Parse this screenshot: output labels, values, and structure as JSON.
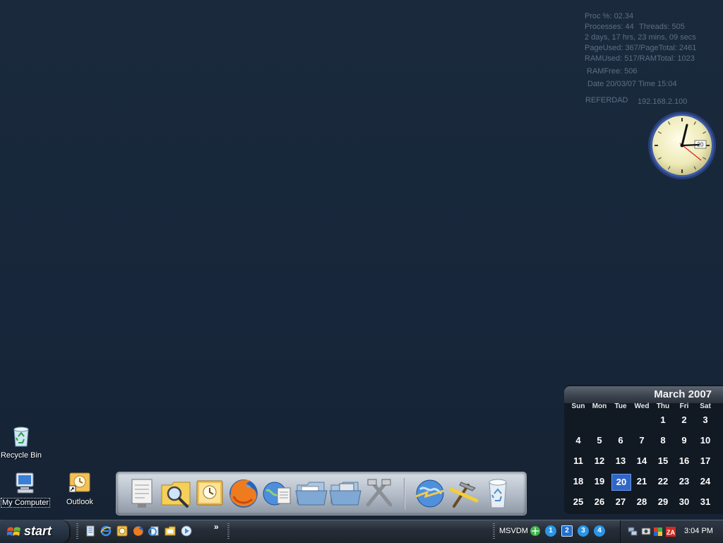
{
  "sysinfo": {
    "proc": "Proc %: 02.34",
    "processes": "Processes: 44",
    "threads": "Threads: 505",
    "uptime": "2 days, 17 hrs, 23 mins, 09 secs",
    "page": "PageUsed: 367/PageTotal: 2461",
    "ram": "RAMUsed: 517/RAMTotal: 1023",
    "ramfree": "RAMFree: 506",
    "datetime": "Date 20/03/07 Time 15:04",
    "hostname": "REFERDAD",
    "ip": "192.168.2.100"
  },
  "clock": {
    "date_badge": "20"
  },
  "desktop_icons": {
    "recycle_bin": "Recycle Bin",
    "my_computer": "My Computer",
    "outlook": "Outlook"
  },
  "dock": {
    "items": [
      "documents",
      "search",
      "outlook",
      "firefox",
      "internet-explorer",
      "folder",
      "folder-network",
      "system-tools",
      "network",
      "tools",
      "recycle-bin"
    ]
  },
  "calendar": {
    "title": "March 2007",
    "weekdays": [
      "Sun",
      "Mon",
      "Tue",
      "Wed",
      "Thu",
      "Fri",
      "Sat"
    ],
    "days": [
      "1",
      "2",
      "3",
      "4",
      "5",
      "6",
      "7",
      "8",
      "9",
      "10",
      "11",
      "12",
      "13",
      "14",
      "15",
      "16",
      "17",
      "18",
      "19",
      "20",
      "21",
      "22",
      "23",
      "24",
      "25",
      "26",
      "27",
      "28",
      "29",
      "30",
      "31"
    ],
    "first_weekday": 4,
    "today": "20"
  },
  "taskbar": {
    "start_label": "start",
    "quicklaunch_more": "»",
    "vdm_label": "MSVDM",
    "desktops": [
      "1",
      "2",
      "3",
      "4"
    ],
    "active_desktop": "2",
    "clock": "3:04 PM"
  },
  "colors": {
    "desktop_bg": "#182536",
    "accent_blue": "#2f66c8",
    "sysinfo_text": "#5d6f86"
  }
}
